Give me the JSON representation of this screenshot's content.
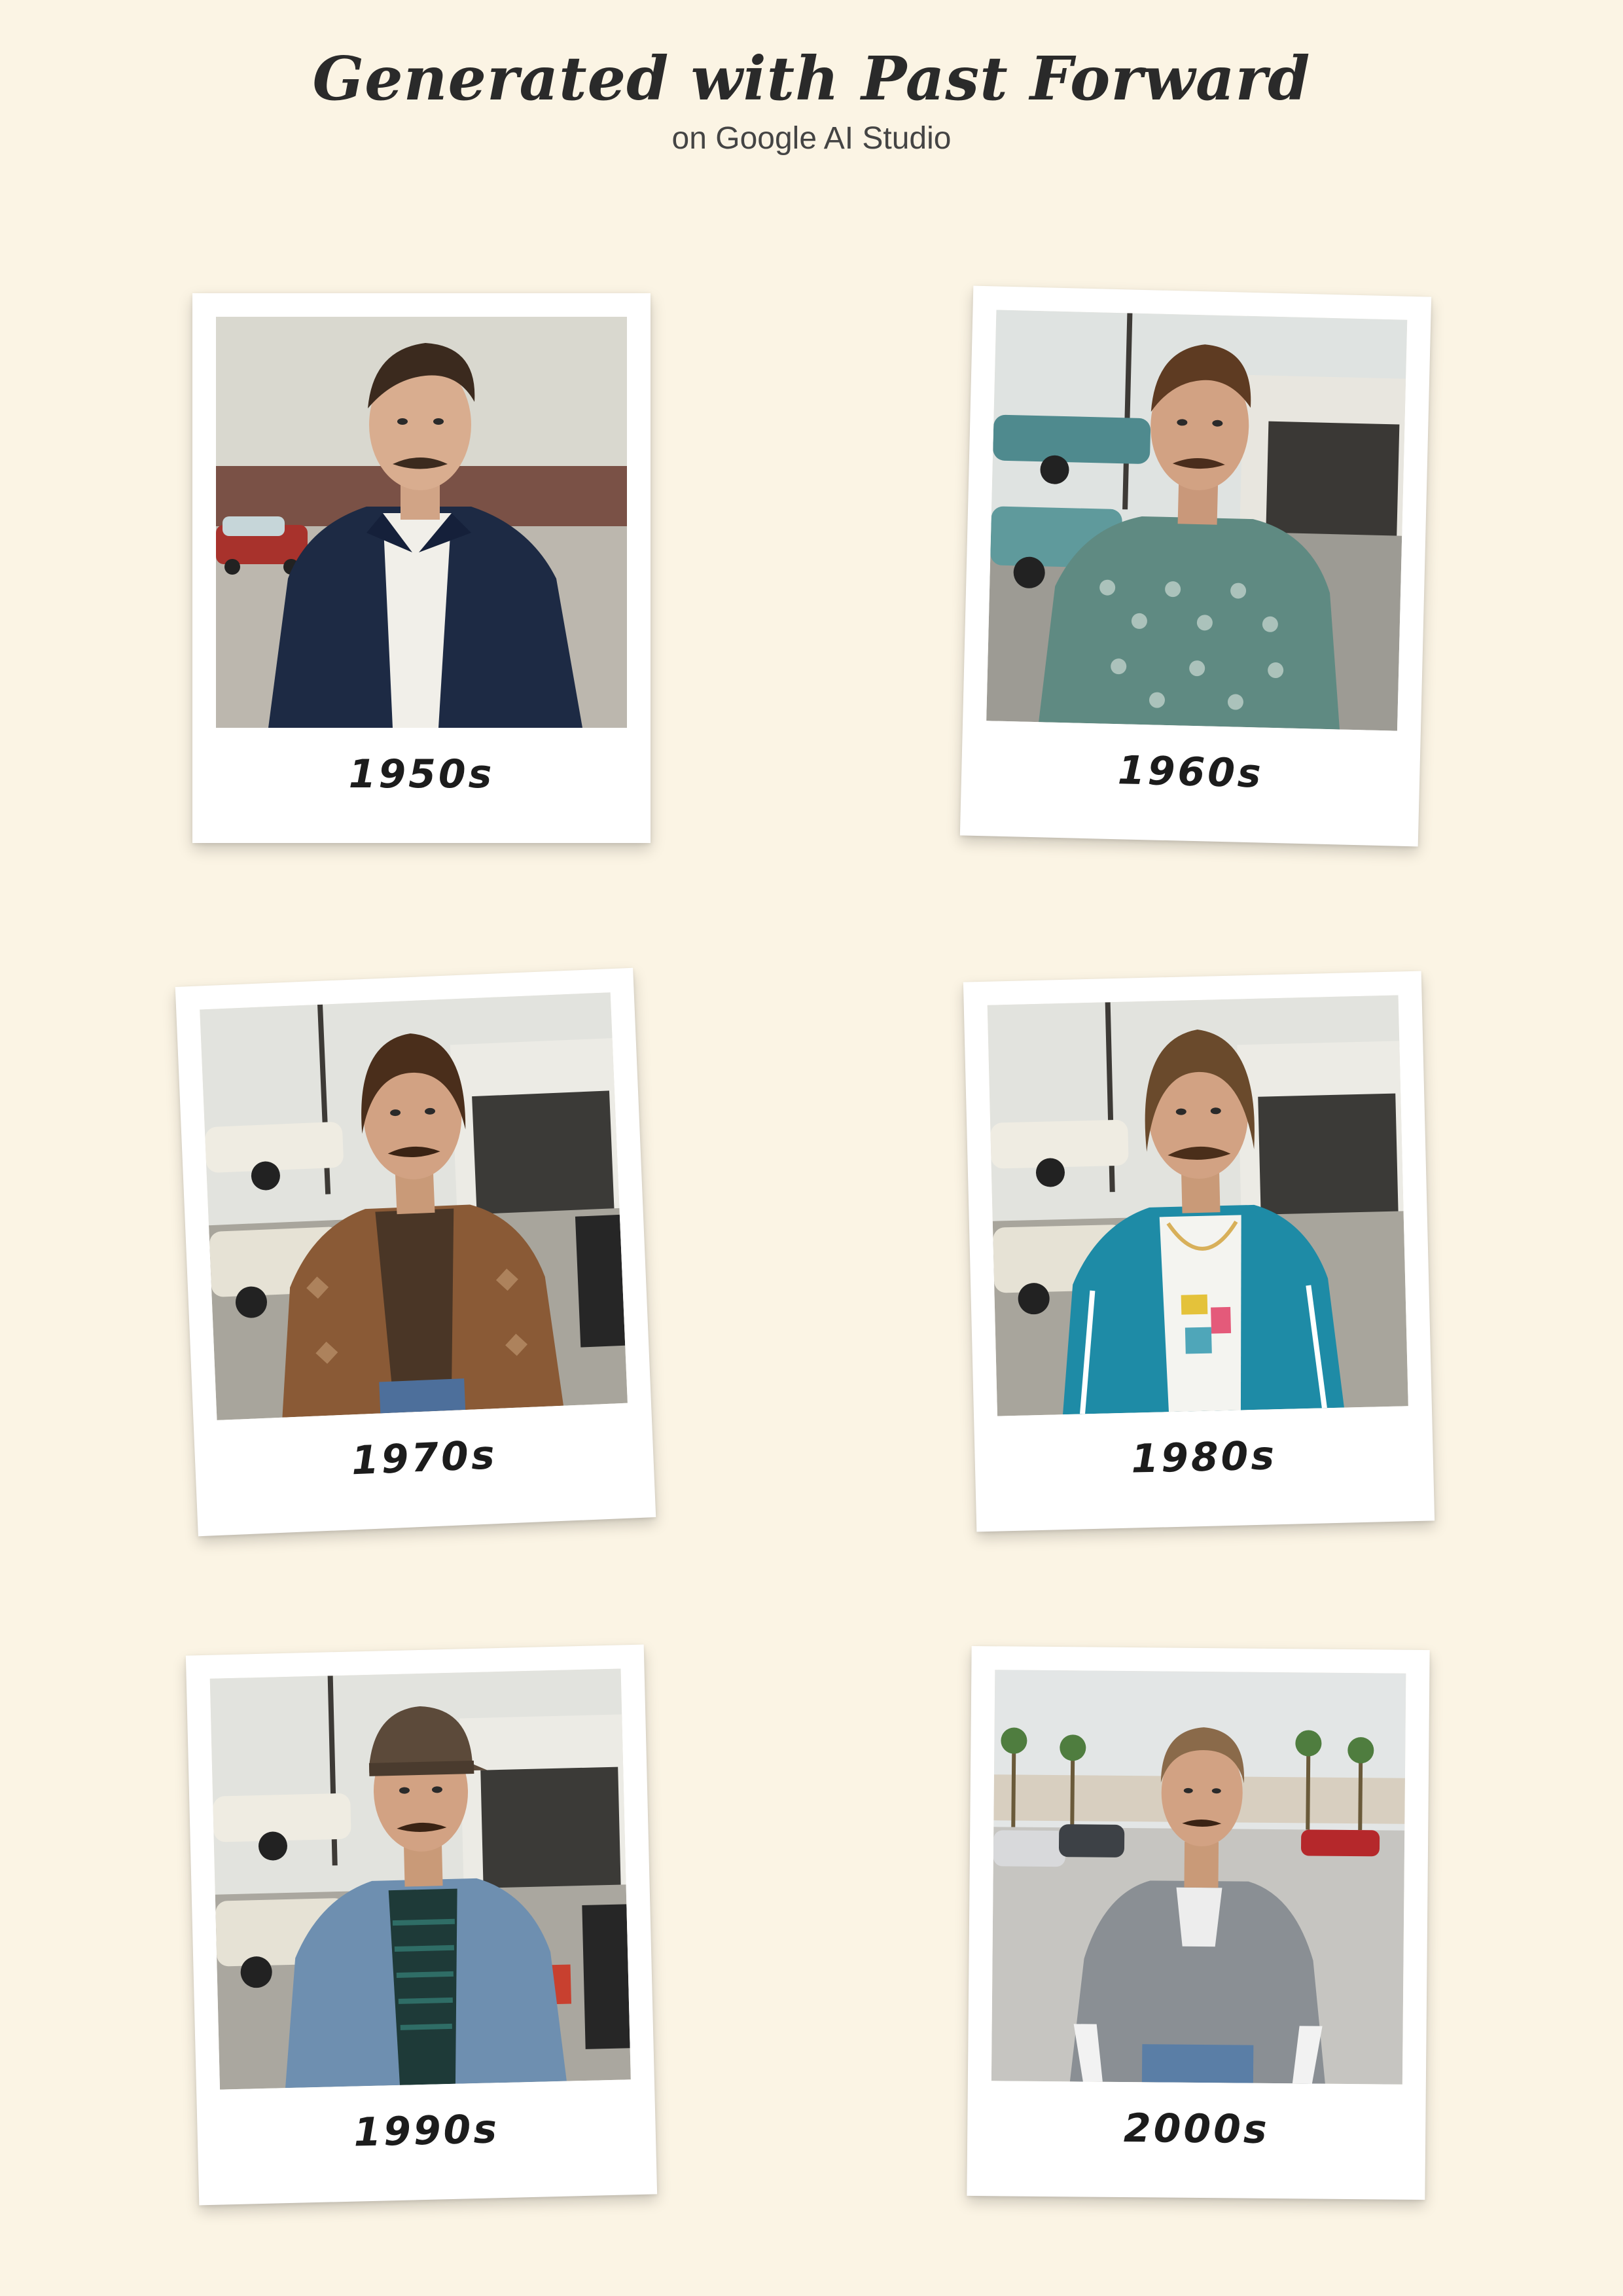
{
  "header": {
    "title": "Generated with Past Forward",
    "subtitle": "on Google AI Studio"
  },
  "polaroids": [
    {
      "caption": "1950s",
      "outfit": "navy work jacket over white tee",
      "background": "brick wall parking lot with red vintage car",
      "accent": "#1d2a44"
    },
    {
      "caption": "1960s",
      "outfit": "green patterned short-sleeve shirt",
      "background": "auto shop with teal classic cars",
      "accent": "#5f8a82"
    },
    {
      "caption": "1970s",
      "outfit": "brown paisley shirt over brown tank, jeans",
      "background": "auto shop with white muscle cars",
      "accent": "#8a5a36"
    },
    {
      "caption": "1980s",
      "outfit": "teal track jacket with graphic tee and gold chain",
      "background": "auto shop with white muscle cars",
      "accent": "#1e8ba6"
    },
    {
      "caption": "1990s",
      "outfit": "denim jacket over striped shirt, cap",
      "background": "auto shop with tires",
      "accent": "#6e8fb0"
    },
    {
      "caption": "2000s",
      "outfit": "grey short-sleeve hoodie over white long sleeve, jeans",
      "background": "parking lot with palm trees",
      "accent": "#8a8f94"
    }
  ]
}
